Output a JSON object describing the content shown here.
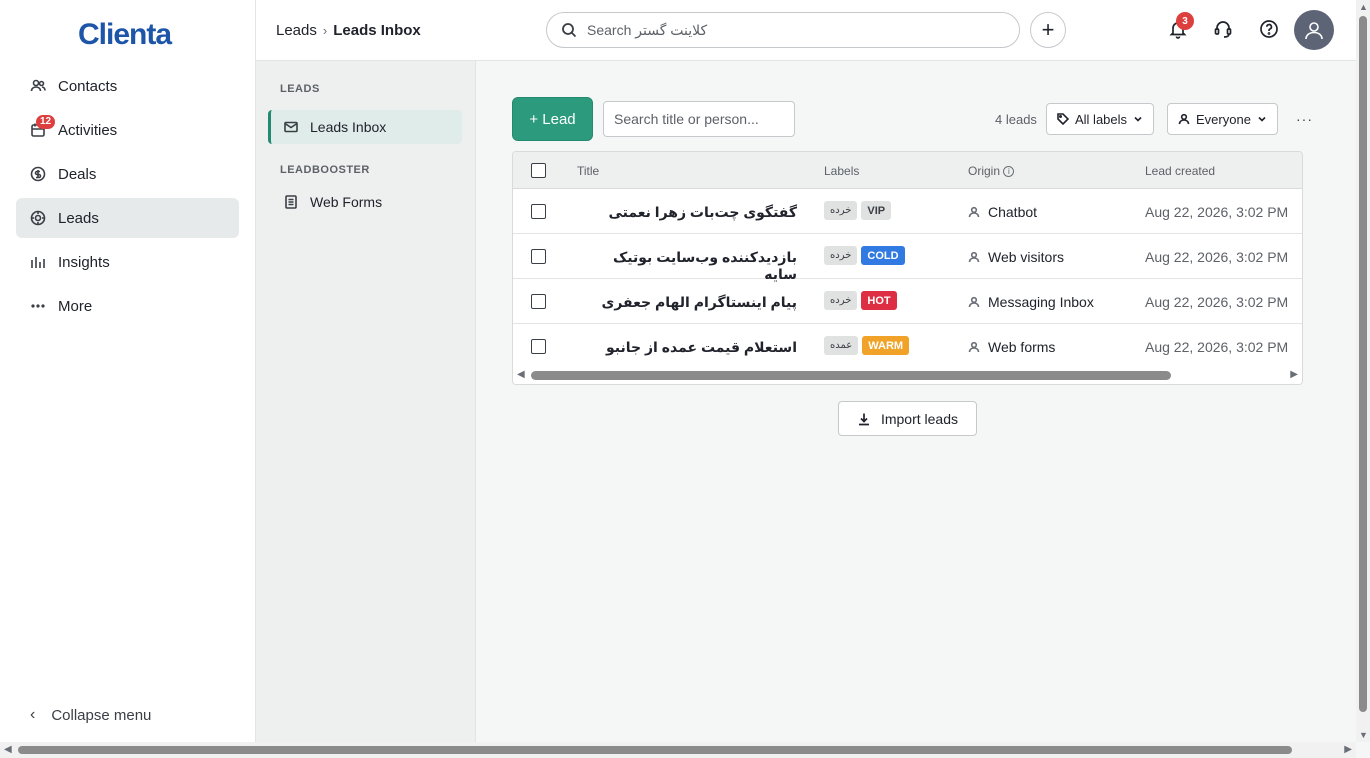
{
  "app": {
    "logo": "Clienta"
  },
  "sidebar": {
    "items": [
      {
        "label": "Contacts",
        "icon": "contacts-icon"
      },
      {
        "label": "Activities",
        "icon": "calendar-icon",
        "badge": "12"
      },
      {
        "label": "Deals",
        "icon": "dollar-icon"
      },
      {
        "label": "Leads",
        "icon": "target-icon",
        "active": true
      },
      {
        "label": "Insights",
        "icon": "bar-chart-icon"
      },
      {
        "label": "More",
        "icon": "more-dots-icon"
      }
    ],
    "collapse_label": "Collapse menu"
  },
  "topbar": {
    "breadcrumb": {
      "parent": "Leads",
      "separator": "›",
      "current": "Leads Inbox"
    },
    "search_placeholder": "Search کلاینت گستر",
    "add_label": "+",
    "notification_count": "3"
  },
  "subnav": {
    "section1": "LEADS",
    "inbox": "Leads Inbox",
    "section2": "LEADBOOSTER",
    "web_forms": "Web Forms"
  },
  "toolbar": {
    "add_lead": "+ Lead",
    "filter_placeholder": "Search title or person...",
    "lead_count": "4 leads",
    "labels_filter": "All labels",
    "owner_filter": "Everyone",
    "more": "···"
  },
  "table": {
    "headers": {
      "title": "Title",
      "labels": "Labels",
      "origin": "Origin",
      "created": "Lead created"
    },
    "rows": [
      {
        "title": "گفتگوی چت‌بات زهرا نعمتی",
        "tag": "خرده",
        "label": "VIP",
        "label_color": "#e0e2e2",
        "origin": "Chatbot",
        "created": "Aug 22, 2026, 3:02 PM"
      },
      {
        "title": "بازدیدکننده وب‌سایت بوتیک سایه",
        "tag": "خرده",
        "label": "COLD",
        "label_color": "#317ae2",
        "origin": "Web visitors",
        "created": "Aug 22, 2026, 3:02 PM"
      },
      {
        "title": "پیام اینستاگرام الهام جعفری",
        "tag": "خرده",
        "label": "HOT",
        "label_color": "#dd2e44",
        "origin": "Messaging Inbox",
        "created": "Aug 22, 2026, 3:02 PM"
      },
      {
        "title": "استعلام قیمت عمده از جانبو",
        "tag": "عمده",
        "label": "WARM",
        "label_color": "#f0a328",
        "origin": "Web forms",
        "created": "Aug 22, 2026, 3:02 PM"
      }
    ]
  },
  "import_label": "Import leads",
  "colors": {
    "brand": "#1d55a8",
    "accent": "#2c9a7c",
    "badge": "#dd3e3e"
  }
}
